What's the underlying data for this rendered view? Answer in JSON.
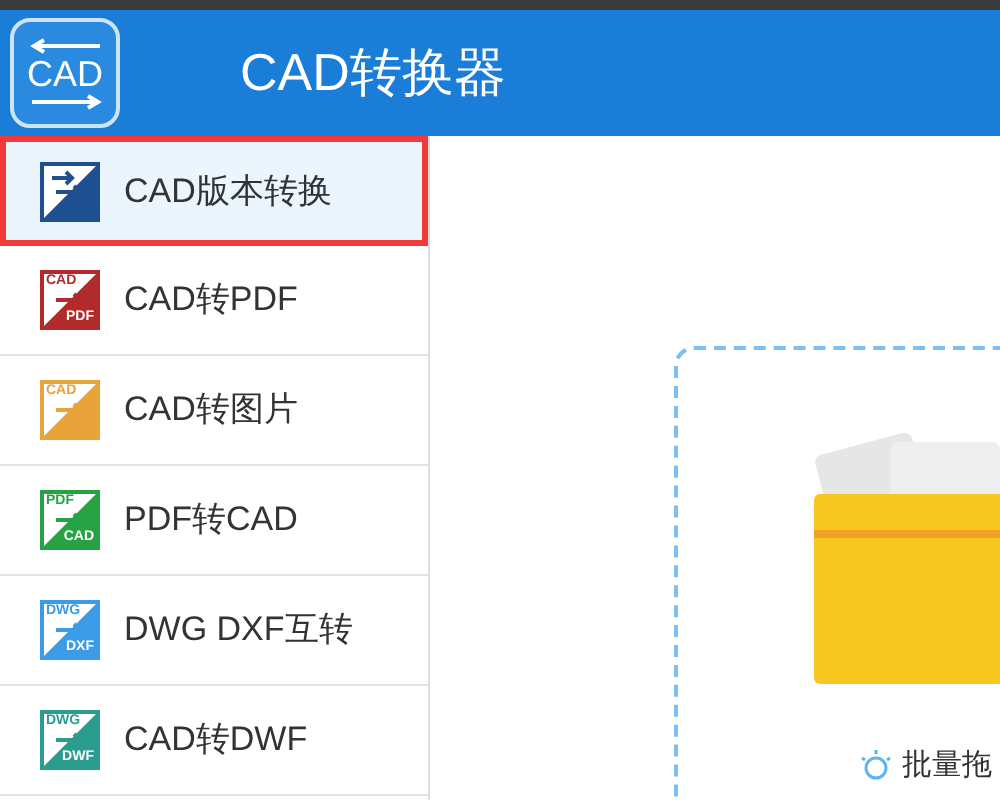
{
  "header": {
    "logo_text": "CAD",
    "title": "CAD转换器"
  },
  "sidebar": {
    "items": [
      {
        "label": "CAD版本转换",
        "selected": true,
        "color": "#1d4f91"
      },
      {
        "label": "CAD转PDF",
        "selected": false,
        "color": "#b22a2a",
        "icon_top": "CAD",
        "icon_bottom": "PDF"
      },
      {
        "label": "CAD转图片",
        "selected": false,
        "color": "#e8a33a",
        "icon_top": "CAD"
      },
      {
        "label": "PDF转CAD",
        "selected": false,
        "color": "#27a243",
        "icon_top": "PDF",
        "icon_bottom": "CAD"
      },
      {
        "label": "DWG DXF互转",
        "selected": false,
        "color": "#3b9be6",
        "icon_top": "DWG",
        "icon_bottom": "DXF"
      },
      {
        "label": "CAD转DWF",
        "selected": false,
        "color": "#2a9d8f",
        "icon_top": "DWG",
        "icon_bottom": "DWF"
      }
    ]
  },
  "drop_zone": {
    "hint": "批量拖"
  }
}
